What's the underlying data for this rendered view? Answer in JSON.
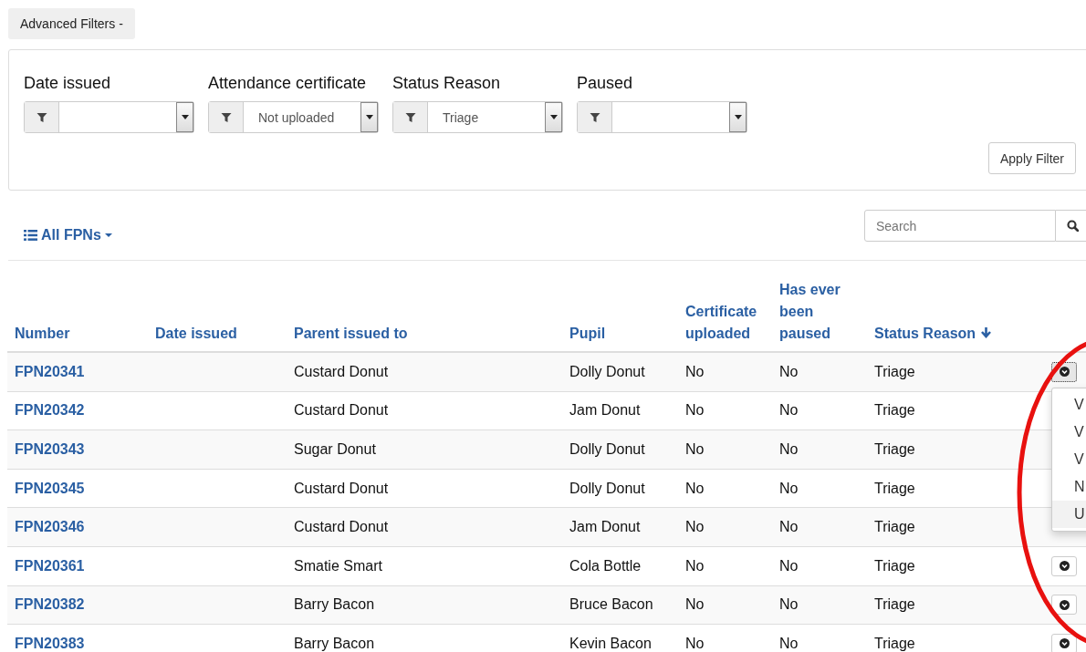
{
  "advanced_filters_button": "Advanced Filters -",
  "filters": [
    {
      "label": "Date issued"
    },
    {
      "label": "Attendance certificate",
      "value": "Not uploaded"
    },
    {
      "label": "Status Reason",
      "value": "Triage"
    },
    {
      "label": "Paused"
    }
  ],
  "apply_button": "Apply Filter",
  "view_menu": "All FPNs",
  "search": {
    "placeholder": "Search"
  },
  "table": {
    "columns": [
      {
        "label": "Number",
        "sorted": false
      },
      {
        "label": "Date issued",
        "sorted": false
      },
      {
        "label": "Parent issued to",
        "sorted": false
      },
      {
        "label": "Pupil",
        "sorted": false
      },
      {
        "label": "Certificate uploaded",
        "sorted": false
      },
      {
        "label": "Has ever been paused",
        "sorted": false
      },
      {
        "label": "Status Reason",
        "sorted": true
      }
    ],
    "rows": [
      {
        "cells": [
          "FPN20341",
          null,
          "Custard Donut",
          "Dolly Donut",
          "No",
          "No",
          "Triage"
        ],
        "menu_open": true
      },
      {
        "cells": [
          "FPN20342",
          null,
          "Custard Donut",
          "Jam Donut",
          "No",
          "No",
          "Triage"
        ],
        "menu_open": false
      },
      {
        "cells": [
          "FPN20343",
          null,
          "Sugar Donut",
          "Dolly Donut",
          "No",
          "No",
          "Triage"
        ],
        "menu_open": false
      },
      {
        "cells": [
          "FPN20345",
          null,
          "Custard Donut",
          "Dolly Donut",
          "No",
          "No",
          "Triage"
        ],
        "menu_open": false
      },
      {
        "cells": [
          "FPN20346",
          null,
          "Custard Donut",
          "Jam Donut",
          "No",
          "No",
          "Triage"
        ],
        "menu_open": false
      },
      {
        "cells": [
          "FPN20361",
          null,
          "Smatie Smart",
          "Cola Bottle",
          "No",
          "No",
          "Triage"
        ],
        "menu_open": false
      },
      {
        "cells": [
          "FPN20382",
          null,
          "Barry Bacon",
          "Bruce Bacon",
          "No",
          "No",
          "Triage"
        ],
        "menu_open": false
      },
      {
        "cells": [
          "FPN20383",
          null,
          "Barry Bacon",
          "Kevin Bacon",
          "No",
          "No",
          "Triage"
        ],
        "menu_open": false
      }
    ]
  },
  "row_menu": [
    {
      "label": "V",
      "selected": false
    },
    {
      "label": "V",
      "selected": false
    },
    {
      "label": "V",
      "selected": false
    },
    {
      "label": "N",
      "selected": false
    },
    {
      "label": "U",
      "selected": true
    }
  ],
  "annotation": {
    "kind": "circle"
  }
}
